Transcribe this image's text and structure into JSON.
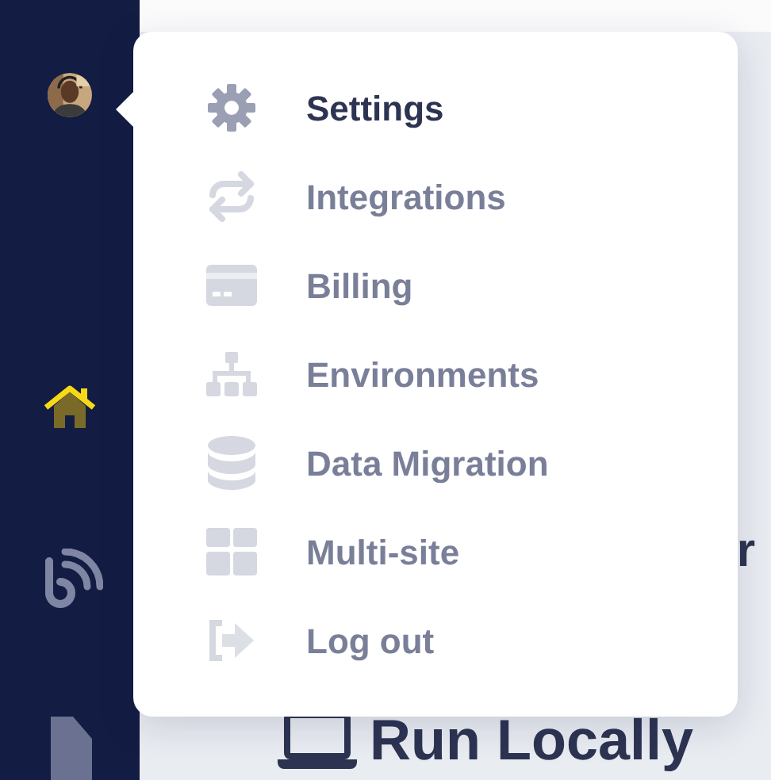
{
  "sidebar": {
    "items": [
      {
        "kind": "home",
        "selected": true
      },
      {
        "kind": "feed",
        "selected": false
      },
      {
        "kind": "document",
        "selected": false
      }
    ]
  },
  "user_menu": {
    "items": [
      {
        "label": "Settings",
        "kind": "gear",
        "selected": true
      },
      {
        "label": "Integrations",
        "kind": "sync",
        "selected": false
      },
      {
        "label": "Billing",
        "kind": "card",
        "selected": false
      },
      {
        "label": "Environments",
        "kind": "tree",
        "selected": false
      },
      {
        "label": "Data Migration",
        "kind": "database",
        "selected": false
      },
      {
        "label": "Multi-site",
        "kind": "grid",
        "selected": false
      },
      {
        "label": "Log out",
        "kind": "logout",
        "selected": false
      }
    ]
  },
  "main": {
    "heading_fragment": "r",
    "section_title": "Run Locally"
  }
}
